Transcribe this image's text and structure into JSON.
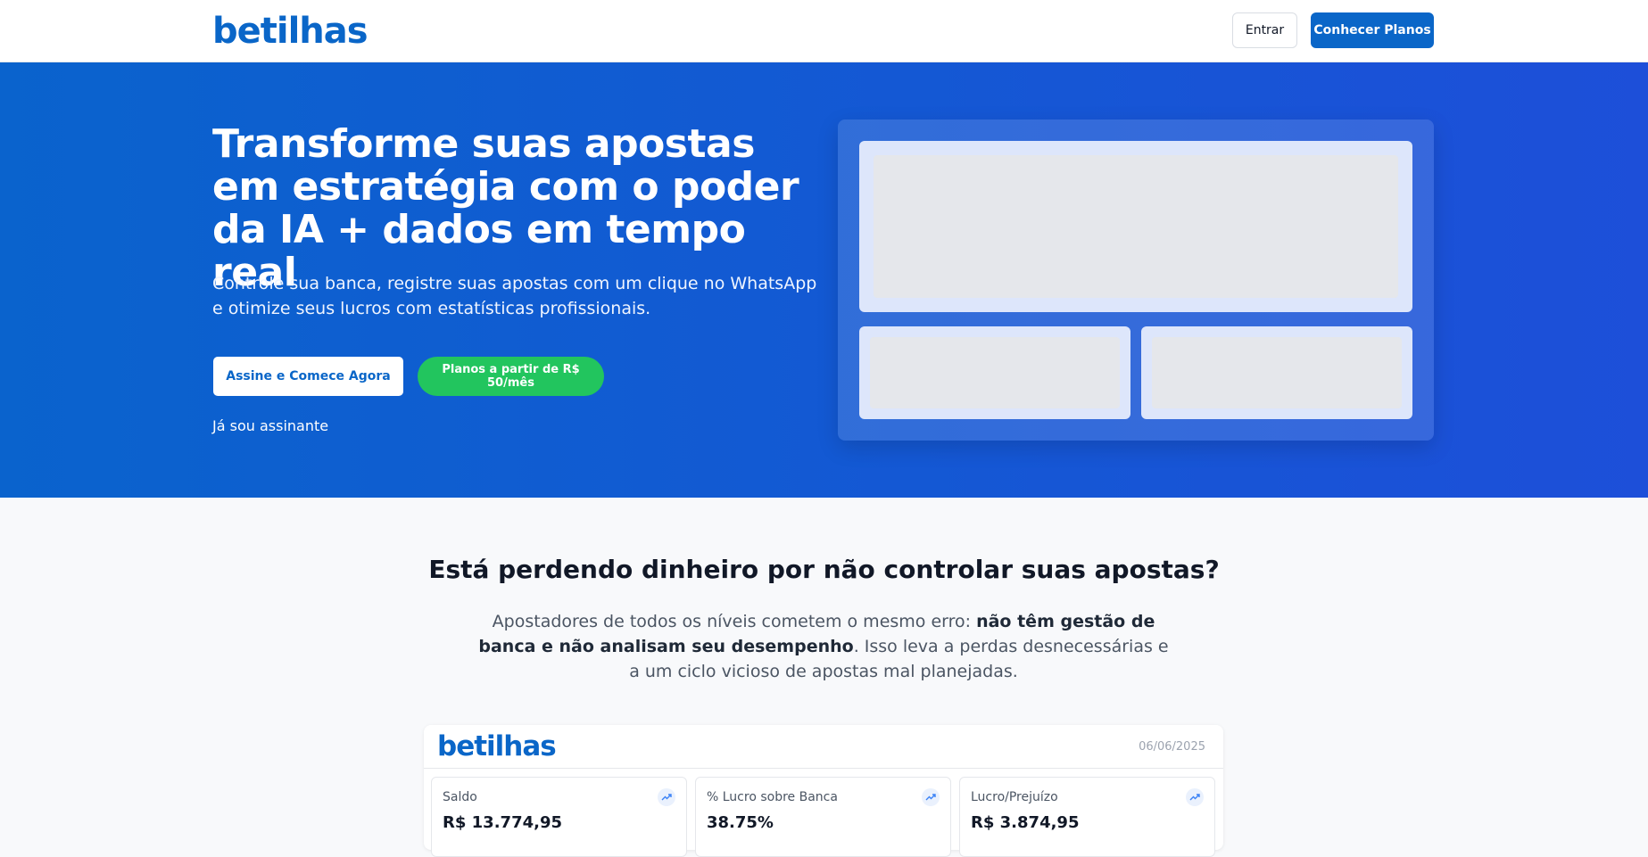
{
  "header": {
    "logo": "betilhas",
    "login_label": "Entrar",
    "plans_label": "Conhecer Planos"
  },
  "hero": {
    "title": "Transforme suas apostas em estratégia com o poder da IA + dados em tempo real",
    "subtitle": "Controle sua banca, registre suas apostas com um clique no WhatsApp e otimize seus lucros com estatísticas profissionais.",
    "cta_primary": "Assine e Comece Agora",
    "cta_secondary": "Planos a partir de R$ 50/mês",
    "subscriber_link": "Já sou assinante"
  },
  "problem": {
    "title": "Está perdendo dinheiro por não controlar suas apostas?",
    "text_1": "Apostadores de todos os níveis cometem o mesmo erro: ",
    "text_bold": "não têm gestão de banca e não analisam seu desempenho",
    "text_2": ". Isso leva a perdas desnecessárias e a um ciclo vicioso de apostas mal planejadas."
  },
  "dashboard": {
    "logo": "betilhas",
    "date": "06/06/2025",
    "stats": [
      {
        "label": "Saldo",
        "value": "R$ 13.774,95",
        "icon": "trending-up-icon"
      },
      {
        "label": "% Lucro sobre Banca",
        "value": "38.75%",
        "icon": "trending-up-icon"
      },
      {
        "label": "Lucro/Prejuízo",
        "value": "R$ 3.874,95",
        "icon": "trending-up-icon"
      }
    ]
  },
  "colors": {
    "brand": "#0a66c8",
    "hero_start": "#0a63cd",
    "hero_end": "#1d4fd9",
    "cta_green": "#22c55e"
  }
}
